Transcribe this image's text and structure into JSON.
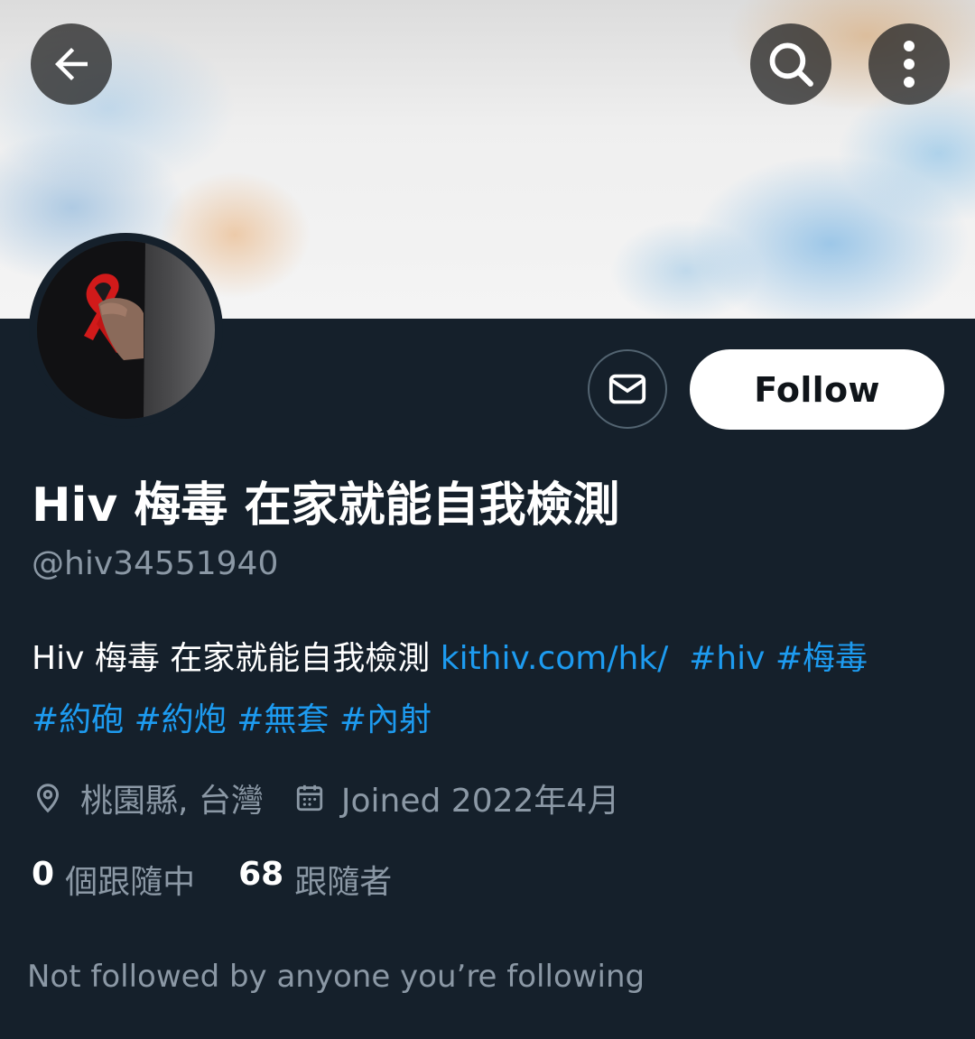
{
  "header": {
    "back_icon": "arrow-left-icon",
    "search_icon": "search-icon",
    "more_icon": "more-vertical-icon"
  },
  "profile": {
    "display_name": "Hiv 梅毒 在家就能自我檢測",
    "handle": "@hiv34551940",
    "bio": {
      "text": "Hiv 梅毒 在家就能自我檢測 ",
      "link": "kithiv.com/hk/",
      "hashtags_line1": "#hiv #梅毒",
      "hashtags_line2": "#約砲 #約炮 #無套 #內射"
    },
    "location": "桃園縣, 台灣",
    "joined": "Joined 2022年4月",
    "following_count": "0",
    "following_label": "個跟隨中",
    "followers_count": "68",
    "followers_label": "跟隨者",
    "mutuals_note": "Not followed by anyone you’re following"
  },
  "actions": {
    "message_icon": "mail-icon",
    "follow_label": "Follow"
  },
  "colors": {
    "background": "#15202b",
    "link": "#1d9bf0",
    "muted": "#8b98a5",
    "ribbon": "#d11a1a"
  }
}
